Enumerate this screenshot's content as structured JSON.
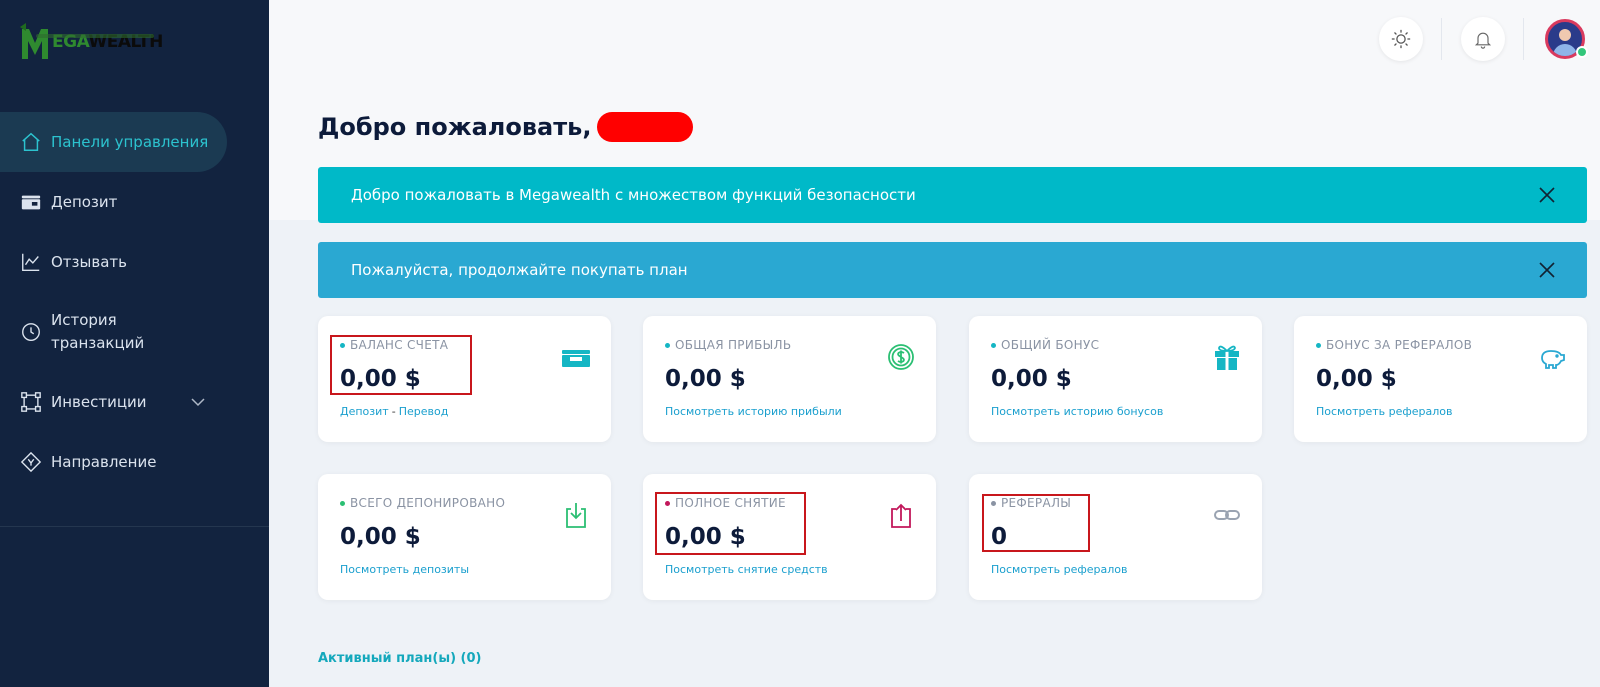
{
  "brand": {
    "logo_text_a": "EGA",
    "logo_text_b": "WEALTH"
  },
  "sidebar": {
    "items": [
      {
        "label": "Панели управления",
        "icon": "home-icon",
        "active": true
      },
      {
        "label": "Депозит",
        "icon": "wallet-icon"
      },
      {
        "label": "Отзывать",
        "icon": "chart-icon"
      },
      {
        "label_line1": "История",
        "label_line2": "транзакций",
        "icon": "clock-icon"
      },
      {
        "label": "Инвестиции",
        "icon": "nodes-icon",
        "expandable": true
      },
      {
        "label": "Направление",
        "icon": "referral-icon"
      }
    ]
  },
  "header": {
    "buttons": [
      "theme-toggle-icon",
      "bell-icon",
      "avatar"
    ]
  },
  "welcome": {
    "title": "Добро пожаловать,"
  },
  "alerts": [
    {
      "text": "Добро пожаловать в Megawealth с множеством функций безопасности",
      "color": "#00b9c8"
    },
    {
      "text": "Пожалуйста, продолжайте покупать план",
      "color": "#2aa8d2"
    }
  ],
  "cards": [
    {
      "label": "БАЛАНС СЧЕТА",
      "value": "0,00 $",
      "link1": "Депозит",
      "link_sep": "-",
      "link2": "Перевод",
      "dot": "#15b6c4",
      "icon": "wallet-icon"
    },
    {
      "label": "ОБЩАЯ ПРИБЫЛЬ",
      "value": "0,00 $",
      "link": "Посмотреть историю прибыли",
      "dot": "#15b6c4",
      "icon": "dollar-circle-icon"
    },
    {
      "label": "ОБЩИЙ БОНУС",
      "value": "0,00 $",
      "link": "Посмотреть историю бонусов",
      "dot": "#15b6c4",
      "icon": "gift-icon"
    },
    {
      "label": "БОНУС ЗА РЕФЕРАЛОВ",
      "value": "0,00 $",
      "link": "Посмотреть рефералов",
      "dot": "#15b6c4",
      "icon": "piggy-bank-icon"
    },
    {
      "label": "ВСЕГО ДЕПОНИРОВАНО",
      "value": "0,00 $",
      "link": "Посмотреть депозиты",
      "dot": "#2bbf73",
      "icon": "download-icon"
    },
    {
      "label": "ПОЛНОЕ СНЯТИЕ",
      "value": "0,00 $",
      "link": "Посмотреть снятие средств",
      "dot": "#c2185b",
      "icon": "upload-icon"
    },
    {
      "label": "РЕФЕРАЛЫ",
      "value": "0",
      "link": "Посмотреть рефералов",
      "dot": "#8a93a3",
      "icon": "link-icon"
    }
  ],
  "active_plans": {
    "label": "Активный план(ы) (0)"
  }
}
